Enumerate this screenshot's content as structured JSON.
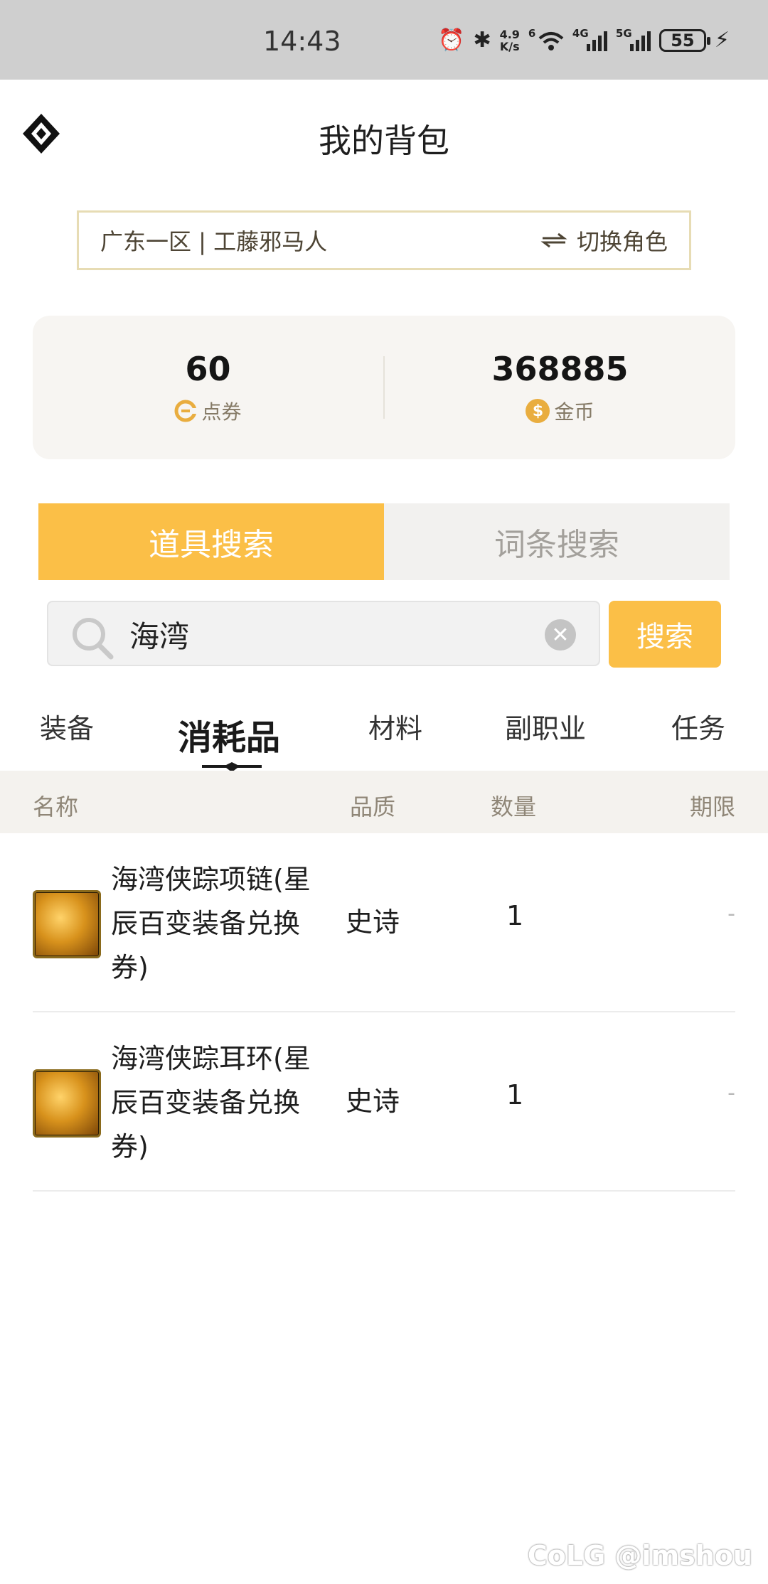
{
  "status_bar": {
    "time": "14:43",
    "net_speed_value": "4.9",
    "net_speed_unit": "K/s",
    "wifi_tag": "6",
    "signal1_tag": "4G",
    "signal2_tag": "5G",
    "battery": "55"
  },
  "header": {
    "title": "我的背包"
  },
  "role": {
    "name": "广东一区 | 工藤邪马人",
    "switch_label": "切换角色"
  },
  "balance": {
    "coupons": {
      "value": "60",
      "label": "点券"
    },
    "gold": {
      "value": "368885",
      "label": "金币"
    }
  },
  "search_tabs": [
    {
      "label": "道具搜索",
      "active": true
    },
    {
      "label": "词条搜索",
      "active": false
    }
  ],
  "search": {
    "query": "海湾",
    "button_label": "搜索"
  },
  "categories": [
    {
      "label": "装备"
    },
    {
      "label": "消耗品",
      "active": true
    },
    {
      "label": "材料"
    },
    {
      "label": "副职业"
    },
    {
      "label": "任务"
    }
  ],
  "table": {
    "headers": {
      "name": "名称",
      "quality": "品质",
      "quantity": "数量",
      "expiry": "期限"
    },
    "rows": [
      {
        "name": "海湾侠踪项链(星辰百变装备兑换券)",
        "quality": "史诗",
        "quantity": "1",
        "expiry": "-"
      },
      {
        "name": "海湾侠踪耳环(星辰百变装备兑换券)",
        "quality": "史诗",
        "quantity": "1",
        "expiry": "-"
      }
    ]
  },
  "watermark": "CoLG @imshou",
  "colors": {
    "accent": "#fbbf47",
    "role_border": "#e7dcb4",
    "card_bg": "#f7f5f2"
  }
}
